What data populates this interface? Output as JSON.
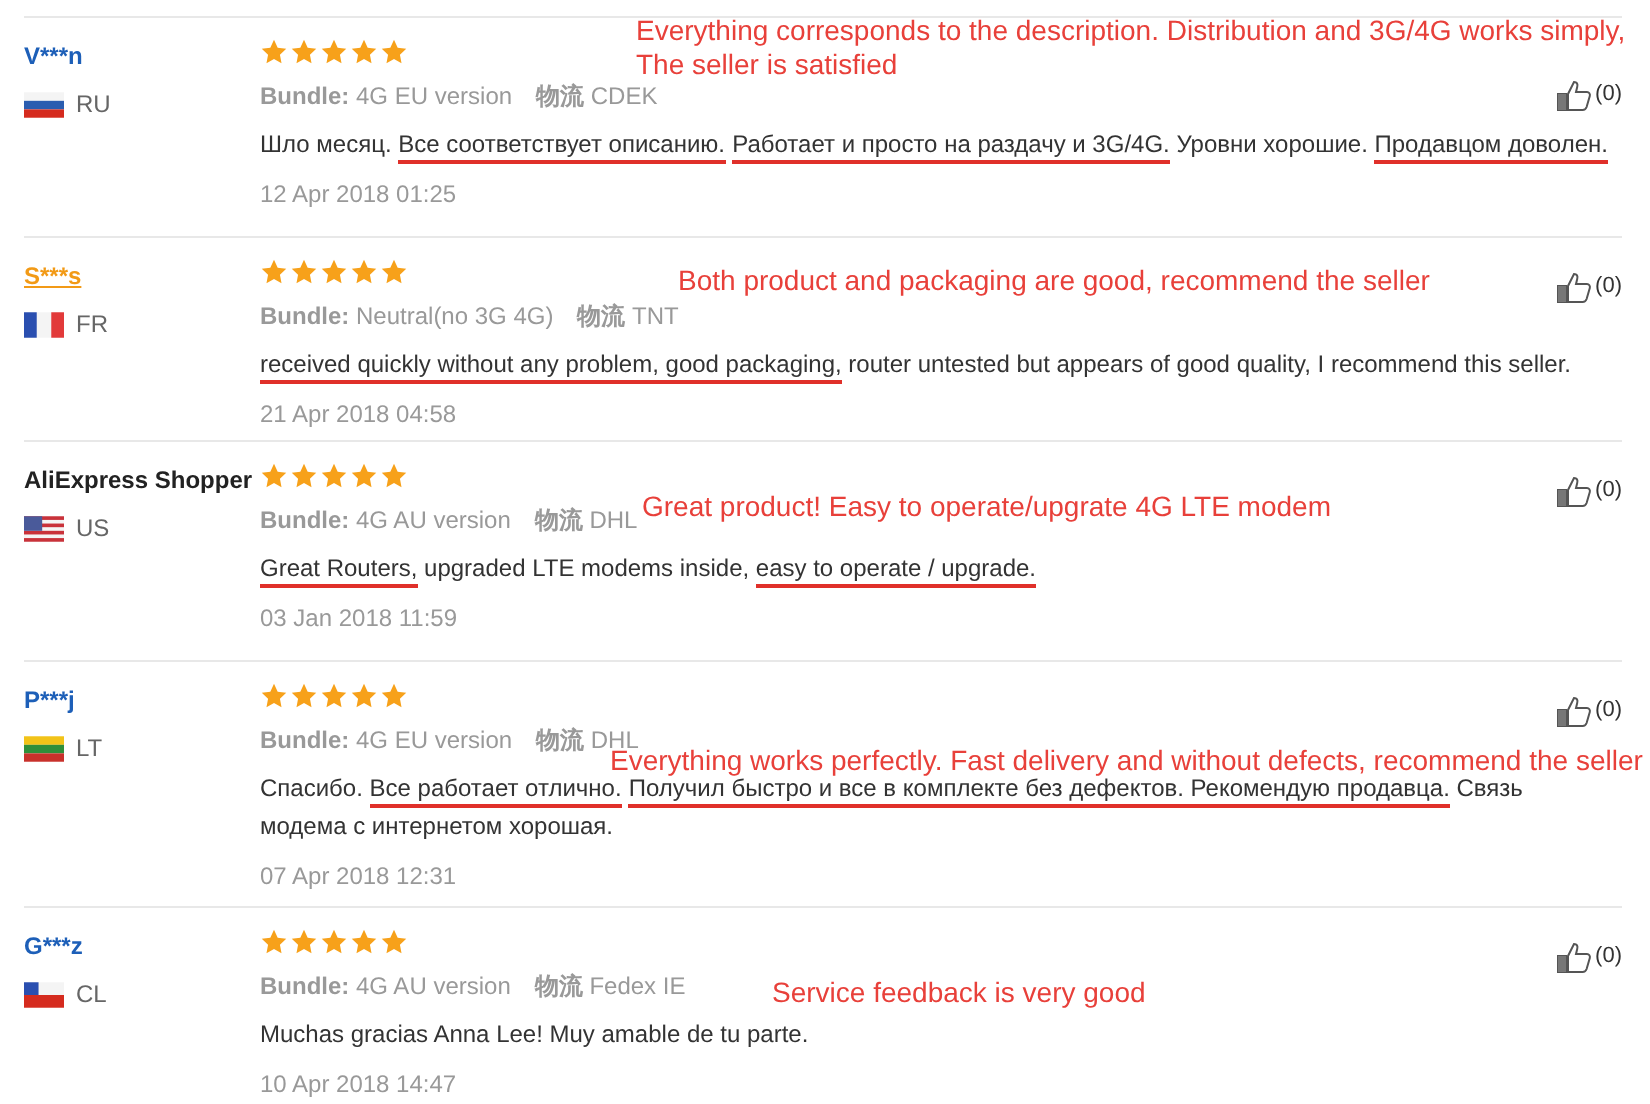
{
  "reviews": [
    {
      "user": "V***n",
      "color": "#1d5fb8",
      "underlined": false,
      "country": "RU",
      "stars": 5,
      "bundle_label": "Bundle:",
      "bundle": "4G EU version",
      "shipping_label": "物流",
      "shipping": "CDEK",
      "likes": "(0)",
      "date": "12 Apr 2018 01:25",
      "text": [
        {
          "text": "Шло месяц. ",
          "underlined": false
        },
        {
          "text": "Все соответствует описанию.",
          "underlined": true
        },
        {
          "text": "Работает и просто на раздачу и 3G/4G.",
          "underlined": true
        },
        {
          "text": " Уровни хорошие. ",
          "underlined": false
        },
        {
          "text": "Продавцом доволен.",
          "underlined": true
        }
      ],
      "annotation": [
        "Everything corresponds to the description. Distribution and 3G/4G works simply,",
        "The seller is satisfied"
      ]
    },
    {
      "user": "S***s",
      "color": "#f29a16",
      "underlined": true,
      "country": "FR",
      "stars": 5,
      "bundle_label": "Bundle:",
      "bundle": "Neutral(no 3G 4G)",
      "shipping_label": "物流",
      "shipping": "TNT",
      "likes": "(0)",
      "date": "21 Apr 2018 04:58",
      "text": [
        {
          "text": "received quickly without any problem, good packaging,",
          "underlined": true
        },
        {
          "text": " router untested but appears of good quality, I recommend this seller.",
          "underlined": false
        }
      ],
      "annotation": [
        "Both product and packaging are good, recommend the seller"
      ]
    },
    {
      "user": "AliExpress Shopper",
      "color": "#222222",
      "underlined": false,
      "country": "US",
      "stars": 5,
      "bundle_label": "Bundle:",
      "bundle": "4G AU version",
      "shipping_label": "物流",
      "shipping": "DHL",
      "likes": "(0)",
      "date": "03 Jan 2018 11:59",
      "text": [
        {
          "text": "Great Routers,",
          "underlined": true
        },
        {
          "text": " upgraded LTE modems inside, ",
          "underlined": false
        },
        {
          "text": "easy to operate / upgrade.",
          "underlined": true
        }
      ],
      "annotation": [
        "Great product! Easy to operate/upgrate 4G LTE modem"
      ]
    },
    {
      "user": "P***j",
      "color": "#1d5fb8",
      "underlined": false,
      "country": "LT",
      "stars": 5,
      "bundle_label": "Bundle:",
      "bundle": "4G EU version",
      "shipping_label": "物流",
      "shipping": "DHL",
      "likes": "(0)",
      "date": "07 Apr 2018 12:31",
      "text": [
        {
          "text": "Спасибо. ",
          "underlined": false
        },
        {
          "text": "Все работает отлично.",
          "underlined": true
        },
        {
          "text": "Получил быстро и все в комплекте без дефектов. Рекомендую продавца.",
          "underlined": true
        },
        {
          "text": " Связь модема с интернетом хорошая.",
          "underlined": false
        }
      ],
      "annotation": [
        "Everything works perfectly. Fast delivery and without defects, recommend the seller"
      ]
    },
    {
      "user": "G***z",
      "color": "#1d5fb8",
      "underlined": false,
      "country": "CL",
      "stars": 5,
      "bundle_label": "Bundle:",
      "bundle": "4G AU version",
      "shipping_label": "物流",
      "shipping": "Fedex IE",
      "likes": "(0)",
      "date": "10 Apr 2018 14:47",
      "text": [
        {
          "text": "Muchas gracias Anna Lee! Muy amable de tu parte.",
          "underlined": false
        }
      ],
      "annotation": [
        "Service feedback is very good"
      ]
    }
  ]
}
